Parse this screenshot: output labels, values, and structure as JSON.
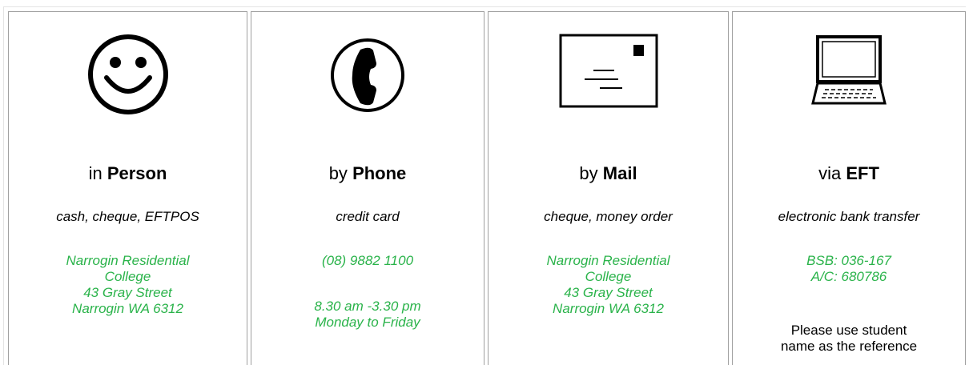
{
  "options": [
    {
      "icon": "smiley-face-icon",
      "prefix": "in",
      "title": "Person",
      "method": "cash, cheque, EFTPOS",
      "details": [
        "Narrogin Residential",
        "College",
        "43 Gray Street",
        "Narrogin WA 6312"
      ]
    },
    {
      "icon": "phone-icon",
      "prefix": "by",
      "title": "Phone",
      "method": "credit card",
      "details": [
        "(08) 9882 1100"
      ],
      "hours": [
        "8.30 am -3.30 pm",
        "Monday to Friday"
      ]
    },
    {
      "icon": "envelope-icon",
      "prefix": "by",
      "title": "Mail",
      "method": "cheque, money order",
      "details": [
        "Narrogin Residential",
        "College",
        "43 Gray Street",
        "Narrogin WA 6312"
      ]
    },
    {
      "icon": "laptop-icon",
      "prefix": "via",
      "title": "EFT",
      "method": "electronic bank transfer",
      "details": [
        "BSB: 036-167",
        "A/C: 680786"
      ],
      "note": [
        "Please use student",
        "name as the reference"
      ]
    }
  ],
  "colors": {
    "accent_green": "#2ab34a",
    "border": "#a0a0a0"
  }
}
